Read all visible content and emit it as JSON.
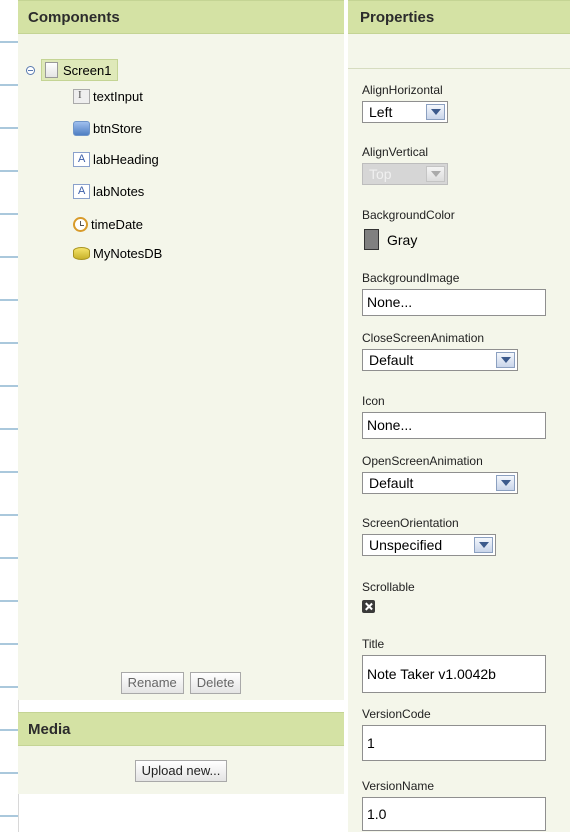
{
  "components": {
    "title": "Components",
    "root": {
      "label": "Screen1"
    },
    "items": [
      {
        "label": "textInput",
        "icon": "textbox-icon"
      },
      {
        "label": "btnStore",
        "icon": "button-icon"
      },
      {
        "label": "labHeading",
        "icon": "label-icon"
      },
      {
        "label": "labNotes",
        "icon": "label-icon"
      },
      {
        "label": "timeDate",
        "icon": "clock-icon"
      },
      {
        "label": "MyNotesDB",
        "icon": "database-icon"
      }
    ],
    "rename_label": "Rename",
    "delete_label": "Delete"
  },
  "media": {
    "title": "Media",
    "upload_label": "Upload new..."
  },
  "properties": {
    "title": "Properties",
    "align_horizontal": {
      "label": "AlignHorizontal",
      "value": "Left"
    },
    "align_vertical": {
      "label": "AlignVertical",
      "value": "Top"
    },
    "background_color": {
      "label": "BackgroundColor",
      "value": "Gray",
      "swatch": "#808080"
    },
    "background_image": {
      "label": "BackgroundImage",
      "value": "None..."
    },
    "close_animation": {
      "label": "CloseScreenAnimation",
      "value": "Default"
    },
    "icon": {
      "label": "Icon",
      "value": "None..."
    },
    "open_animation": {
      "label": "OpenScreenAnimation",
      "value": "Default"
    },
    "orientation": {
      "label": "ScreenOrientation",
      "value": "Unspecified"
    },
    "scrollable": {
      "label": "Scrollable",
      "checked": false
    },
    "title_prop": {
      "label": "Title",
      "value": "Note Taker v1.0042b"
    },
    "version_code": {
      "label": "VersionCode",
      "value": "1"
    },
    "version_name": {
      "label": "VersionName",
      "value": "1.0"
    }
  },
  "colors": {
    "header": "#d4e2a4",
    "panel": "#f4f6ea"
  }
}
